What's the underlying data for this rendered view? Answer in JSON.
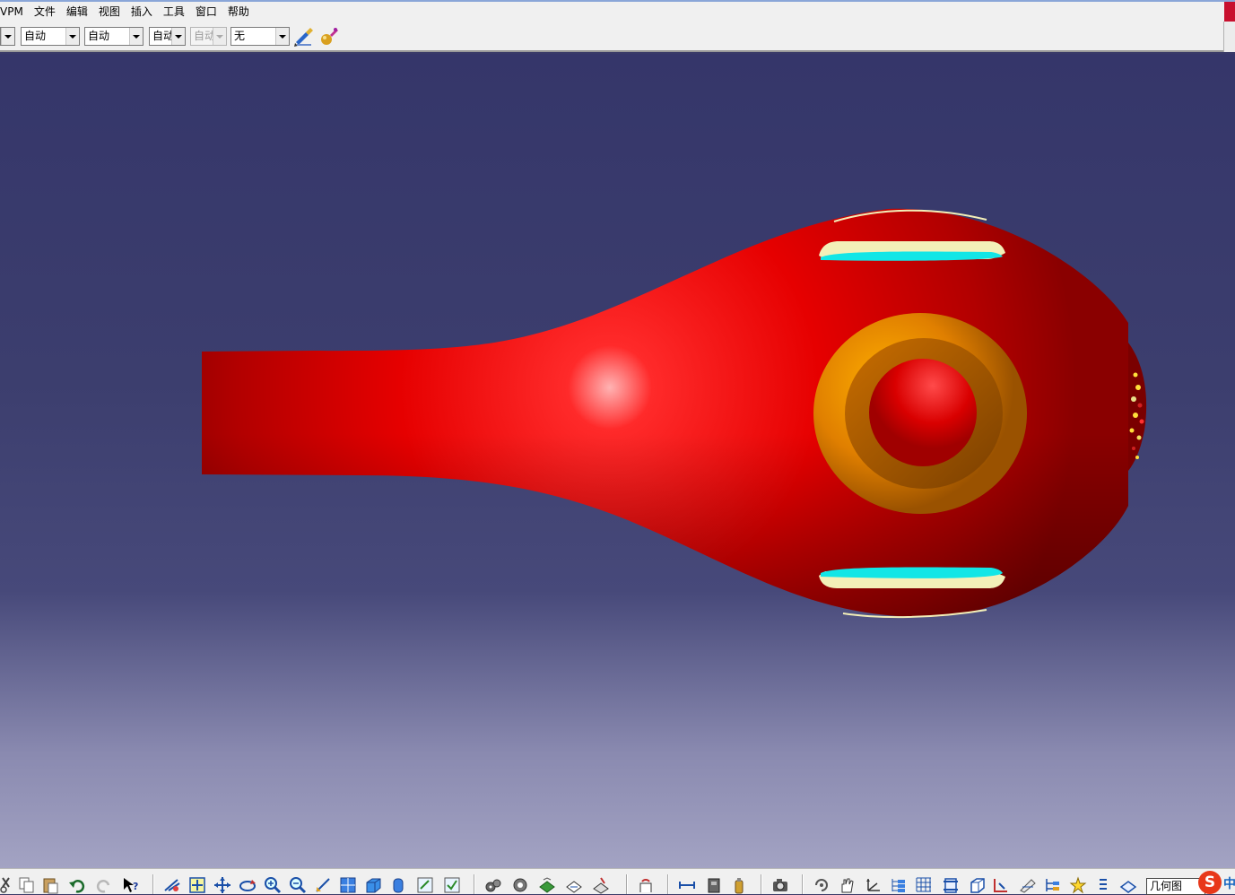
{
  "menu": {
    "items": [
      "VPM",
      "文件",
      "编辑",
      "视图",
      "插入",
      "工具",
      "窗口",
      "帮助"
    ]
  },
  "toolbar": {
    "combos": [
      {
        "value": "",
        "enabled": true
      },
      {
        "value": "自动",
        "enabled": true
      },
      {
        "value": "自动",
        "enabled": true
      },
      {
        "value": "自动",
        "enabled": true
      },
      {
        "value": "自动",
        "enabled": false
      },
      {
        "value": "无",
        "enabled": true
      }
    ],
    "icons": [
      "painter-brush-icon",
      "paint-drop-icon"
    ]
  },
  "model": {
    "body_color": "#e60000",
    "boss_color": "#ef8c00",
    "slot_color": "#12e6e6",
    "slot_edge_color": "#f3efb8",
    "background_top": "#35366a",
    "background_bottom": "#a3a3c3"
  },
  "bottom": {
    "icons": [
      "cut-icon",
      "copy-icon",
      "paste-icon",
      "undo-icon",
      "redo-icon",
      "whats-this-icon",
      "fly-mode-icon",
      "fit-all-icon",
      "pan-icon",
      "rotate-icon",
      "zoom-in-icon",
      "zoom-out-icon",
      "normal-view-icon",
      "quick-view-icon",
      "shading-icon",
      "hide-show-icon",
      "swap-visible-icon",
      "swap-view-icon",
      "gear-icon",
      "mechanism-icon",
      "catalog-icon",
      "measure-icon",
      "analysis-icon",
      "update-icon",
      "distance-icon",
      "apply-material-icon",
      "snapshot-icon",
      "capture-icon",
      "manipulate-icon",
      "axis-icon",
      "tree-icon",
      "grid-icon",
      "scene-icon",
      "box-icon",
      "constraint-icon",
      "sketch-icon",
      "spec-tree-icon",
      "favorites-icon",
      "layer-icon",
      "layer-filter-icon"
    ],
    "geometry_field": "几何图",
    "ime_badge": "S",
    "ime_lang": "中"
  }
}
